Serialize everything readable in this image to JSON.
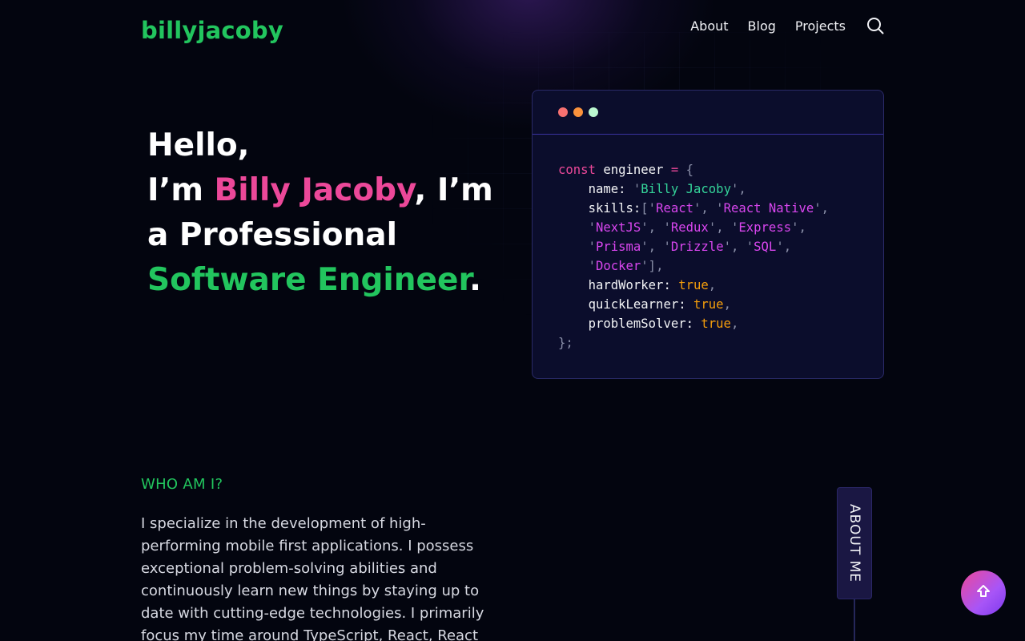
{
  "header": {
    "logo": "billyjacoby",
    "nav": [
      {
        "label": "About"
      },
      {
        "label": "Blog"
      },
      {
        "label": "Projects"
      }
    ],
    "search_icon": "search-icon"
  },
  "hero": {
    "line1": "Hello,",
    "im_prefix": "I’m ",
    "name": "Billy Jacoby",
    "im_suffix": ", I’m",
    "line3": "a Professional",
    "role": "Software Engineer",
    "period": "."
  },
  "code": {
    "window_dots": [
      "#f87171",
      "#fb923c",
      "#bbf7d0"
    ],
    "const_kw": "const",
    "var_name": "engineer",
    "eq": "=",
    "open": "{",
    "name_key": "name:",
    "name_val": "Billy Jacoby",
    "skills_key": "skills:",
    "skills": [
      "React",
      "React Native",
      "NextJS",
      "Redux",
      "Express",
      "Prisma",
      "Drizzle",
      "SQL",
      "Docker"
    ],
    "hardWorker_key": "hardWorker:",
    "quickLearner_key": "quickLearner:",
    "problemSolver_key": "problemSolver:",
    "true_val": "true",
    "close": "};"
  },
  "about": {
    "heading": "WHO AM I?",
    "text": "I specialize in the development of high-performing mobile first applications. I possess exceptional problem-solving abilities and continuously learn new things by staying up to date with cutting-edge technologies. I primarily focus my time around TypeScript, React, React",
    "tab_label": "ABOUT ME"
  },
  "scroll_top_icon": "arrow-up-icon",
  "colors": {
    "accent_green": "#22c55e",
    "accent_pink": "#ec4899",
    "background": "#03050f"
  }
}
